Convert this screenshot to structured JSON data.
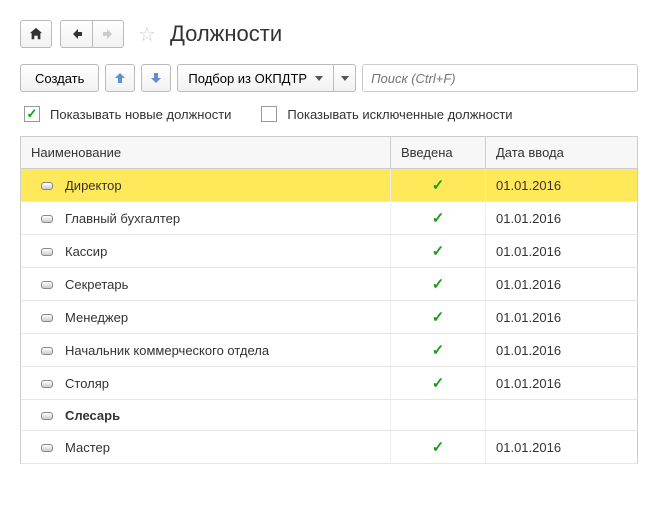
{
  "title": "Должности",
  "toolbar": {
    "create_label": "Создать",
    "pick_label": "Подбор из ОКПДТР"
  },
  "search": {
    "placeholder": "Поиск (Ctrl+F)"
  },
  "filters": {
    "show_new_label": "Показывать новые должности",
    "show_excluded_label": "Показывать исключенные должности"
  },
  "columns": {
    "name": "Наименование",
    "introduced": "Введена",
    "date": "Дата ввода"
  },
  "rows": [
    {
      "name": "Директор",
      "introduced": true,
      "date": "01.01.2016",
      "selected": true,
      "bold": false
    },
    {
      "name": "Главный бухгалтер",
      "introduced": true,
      "date": "01.01.2016",
      "selected": false,
      "bold": false
    },
    {
      "name": "Кассир",
      "introduced": true,
      "date": "01.01.2016",
      "selected": false,
      "bold": false
    },
    {
      "name": "Секретарь",
      "introduced": true,
      "date": "01.01.2016",
      "selected": false,
      "bold": false
    },
    {
      "name": "Менеджер",
      "introduced": true,
      "date": "01.01.2016",
      "selected": false,
      "bold": false
    },
    {
      "name": "Начальник коммерческого отдела",
      "introduced": true,
      "date": "01.01.2016",
      "selected": false,
      "bold": false
    },
    {
      "name": "Столяр",
      "introduced": true,
      "date": "01.01.2016",
      "selected": false,
      "bold": false
    },
    {
      "name": "Слесарь",
      "introduced": false,
      "date": "",
      "selected": false,
      "bold": true
    },
    {
      "name": "Мастер",
      "introduced": true,
      "date": "01.01.2016",
      "selected": false,
      "bold": false
    }
  ]
}
